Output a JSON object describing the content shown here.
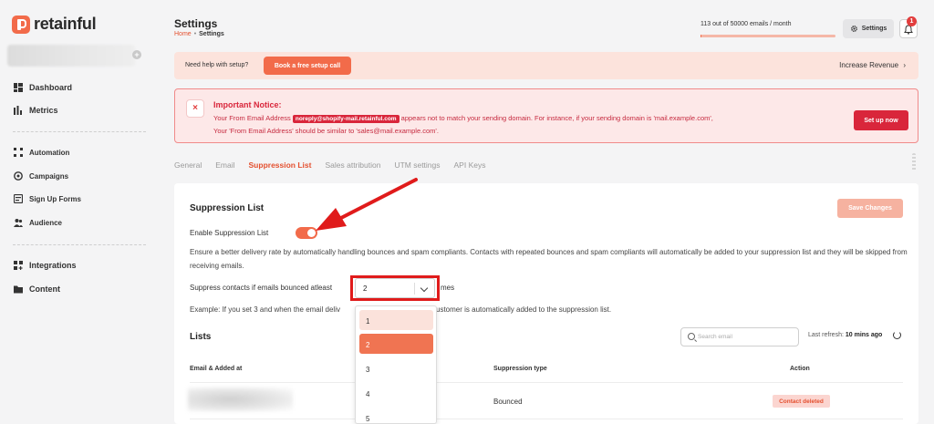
{
  "app": {
    "name": "retainful"
  },
  "sidebar": {
    "add_label": "+",
    "items": [
      {
        "label": "Dashboard",
        "icon": "dashboard-icon"
      },
      {
        "label": "Metrics",
        "icon": "metrics-icon"
      },
      {
        "label": "Automation",
        "icon": "automation-icon"
      },
      {
        "label": "Campaigns",
        "icon": "campaigns-icon"
      },
      {
        "label": "Sign Up Forms",
        "icon": "signup-forms-icon"
      },
      {
        "label": "Audience",
        "icon": "audience-icon"
      },
      {
        "label": "Integrations",
        "icon": "integrations-icon"
      },
      {
        "label": "Content",
        "icon": "folder-icon"
      }
    ]
  },
  "header": {
    "title": "Settings",
    "breadcrumb": {
      "home": "Home",
      "current": "Settings"
    },
    "usage_text": "113 out of 50000 emails / month",
    "usage_fraction": 0.00226,
    "settings_label": "Settings",
    "notification_count": "1"
  },
  "setup_banner": {
    "text": "Need help with setup?",
    "button": "Book a free setup call",
    "link": "Increase Revenue",
    "link_chevron": "›"
  },
  "notice": {
    "title": "Important Notice:",
    "body_prefix": "Your From Email Address",
    "email": "noreply@shopify-mail.retainful.com",
    "body_suffix": "appears not to match your sending domain. For instance, if your sending domain is 'mail.example.com', Your 'From Email Address' should be similar to 'sales@mail.example.com'.",
    "button": "Set up now"
  },
  "tabs": [
    {
      "label": "General",
      "active": false
    },
    {
      "label": "Email",
      "active": false
    },
    {
      "label": "Suppression List",
      "active": true
    },
    {
      "label": "Sales attribution",
      "active": false
    },
    {
      "label": "UTM settings",
      "active": false
    },
    {
      "label": "API Keys",
      "active": false
    }
  ],
  "suppression": {
    "title": "Suppression List",
    "save_button": "Save Changes",
    "enable_label": "Enable Suppression List",
    "enabled": true,
    "description": "Ensure a better delivery rate by automatically handling bounces and spam compliants. Contacts with repeated bounces and spam compliants will automatically be added to your suppression list and they will be skipped from receiving emails.",
    "threshold_label": "Suppress contacts if emails bounced atleast",
    "threshold_value": "2",
    "times_label": "mes",
    "example_part1": "Example: If you set 3 and when the email deliv",
    "example_part2": "ustomer is automatically added to the suppression list.",
    "dropdown_options": [
      "1",
      "2",
      "3",
      "4",
      "5"
    ],
    "dropdown_hover": "1",
    "dropdown_selected": "2"
  },
  "lists": {
    "title": "Lists",
    "search_placeholder": "Search email",
    "refresh_label": "Last refresh:",
    "refresh_value": "10 mins ago",
    "columns": [
      "Email & Added at",
      "Suppression type",
      "Action"
    ],
    "rows": [
      {
        "type": "Bounced",
        "action": "Contact deleted"
      }
    ]
  },
  "colors": {
    "accent": "#f26b4a",
    "danger": "#d9263b",
    "annotation": "#e01b1b"
  }
}
